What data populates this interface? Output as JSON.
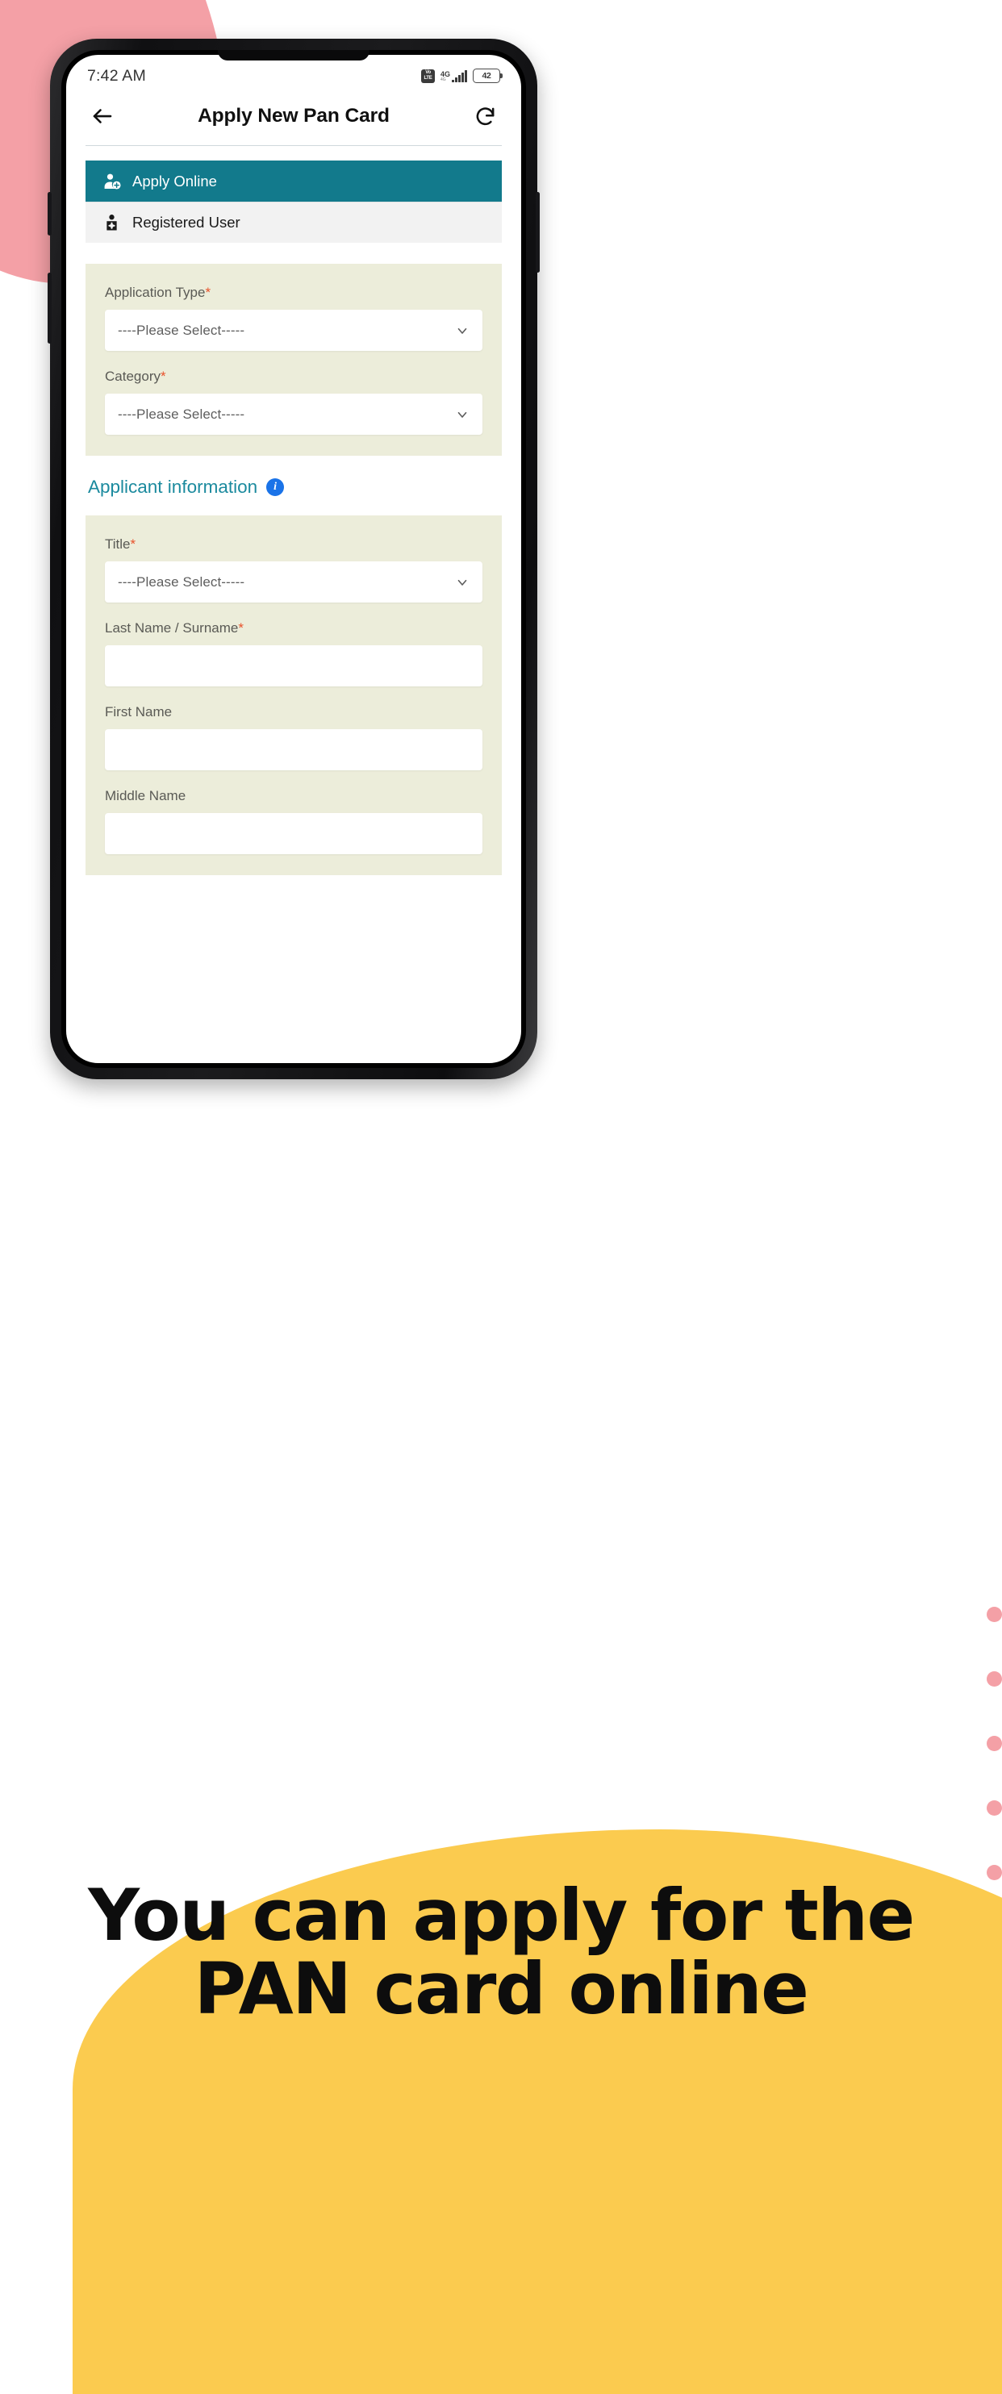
{
  "decor": {
    "pink_color": "#F4A0A6",
    "yellow_color": "#FBCB4F",
    "dot_count": 5
  },
  "status_bar": {
    "clock": "7:42 AM",
    "volte_line1": "Vo",
    "volte_line2": "LTE",
    "network_label": "4G",
    "network_sub": "4G",
    "signal_bars": 5,
    "battery_level": "42"
  },
  "app_bar": {
    "back_icon": "arrow-left-icon",
    "title": "Apply New Pan Card",
    "refresh_icon": "refresh-icon"
  },
  "tabs": [
    {
      "label": "Apply Online",
      "icon": "user-plus-icon",
      "active": true,
      "color": "#127A8C"
    },
    {
      "label": "Registered User",
      "icon": "user-registered-icon",
      "active": false,
      "color": "#f2f2f2"
    }
  ],
  "form_top": {
    "panel_color": "#ECEDDA",
    "fields": [
      {
        "label": "Application Type",
        "required": true,
        "value": "----Please Select-----",
        "type": "select"
      },
      {
        "label": "Category",
        "required": true,
        "value": "----Please Select-----",
        "type": "select"
      }
    ]
  },
  "applicant_section": {
    "heading": "Applicant information",
    "heading_color": "#1B8A9E",
    "info_icon": "info-icon",
    "info_glyph": "i",
    "fields": [
      {
        "label": "Title",
        "required": true,
        "value": "----Please Select-----",
        "type": "select"
      },
      {
        "label": "Last Name / Surname",
        "required": true,
        "value": "",
        "placeholder": "",
        "type": "text"
      },
      {
        "label": "First Name",
        "required": false,
        "value": "",
        "placeholder": "",
        "type": "text"
      },
      {
        "label": "Middle Name",
        "required": false,
        "value": "",
        "placeholder": "",
        "type": "text"
      }
    ]
  },
  "caption": {
    "line1": "You can apply for the",
    "line2": "PAN card online"
  }
}
